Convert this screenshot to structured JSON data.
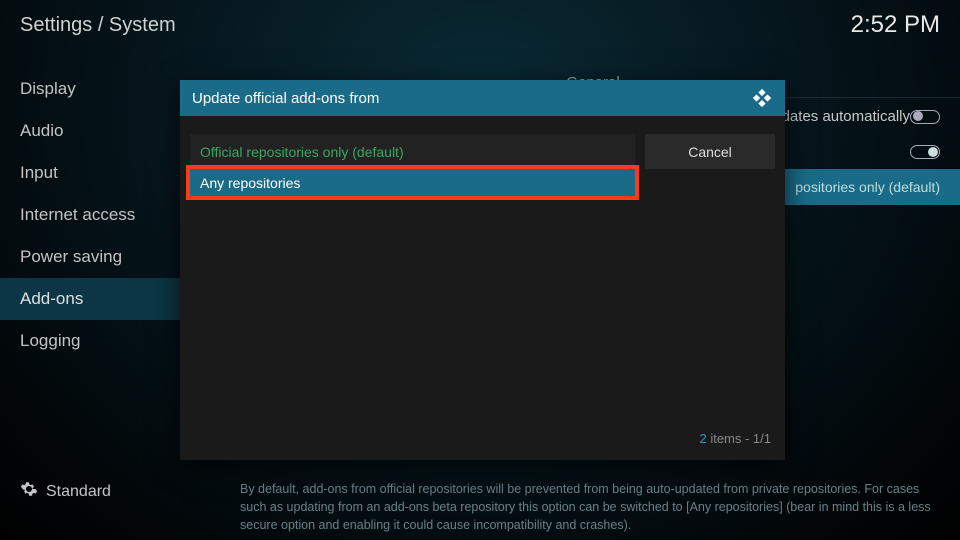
{
  "header": {
    "breadcrumb": "Settings / System",
    "clock": "2:52 PM"
  },
  "sidebar": {
    "items": [
      {
        "label": "Display"
      },
      {
        "label": "Audio"
      },
      {
        "label": "Input"
      },
      {
        "label": "Internet access"
      },
      {
        "label": "Power saving"
      },
      {
        "label": "Add-ons"
      },
      {
        "label": "Logging"
      }
    ],
    "active_index": 5
  },
  "content": {
    "section": "General",
    "rows": [
      {
        "label": "l updates automatically",
        "toggle": false
      },
      {
        "label": "",
        "toggle": true
      },
      {
        "label": "",
        "value": "positories only (default)"
      }
    ]
  },
  "footer": {
    "level": "Standard",
    "help": "By default, add-ons from official repositories will be prevented from being auto-updated from private repositories. For cases such as updating from an add-ons beta repository this option can be switched to [Any repositories] (bear in mind this is a less secure option and enabling it could cause incompatibility and crashes)."
  },
  "dialog": {
    "title": "Update official add-ons from",
    "options": [
      {
        "label": "Official repositories only (default)"
      },
      {
        "label": "Any repositories"
      }
    ],
    "cancel": "Cancel",
    "count_num": "2",
    "count_rest": " items - 1/1"
  }
}
